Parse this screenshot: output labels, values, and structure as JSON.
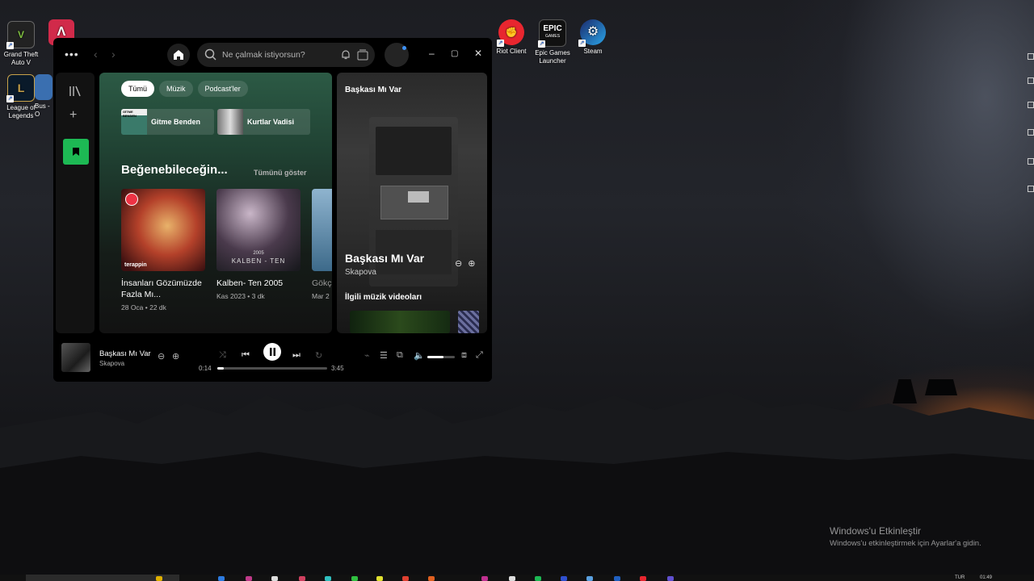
{
  "desktop": {
    "icons": [
      {
        "label": "Grand Theft Auto V",
        "icon": "gta-icon"
      },
      {
        "label": "League of Legends",
        "icon": "lol-icon"
      },
      {
        "label": "Bus - O",
        "icon": "app-icon"
      },
      {
        "label": "Riot Client",
        "icon": "riot-icon"
      },
      {
        "label": "Epic Games Launcher",
        "icon": "epic-icon"
      },
      {
        "label": "Steam",
        "icon": "steam-icon"
      }
    ],
    "epic_logo_text": "EPIC",
    "epic_logo_sub": "GAMES",
    "activation": {
      "title": "Windows'u Etkinleştir",
      "subtitle": "Windows'u etkinleştirmek için Ayarlar'a gidin."
    },
    "tray": {
      "lang": "TUR",
      "time": "01:49"
    }
  },
  "spotify": {
    "search": {
      "placeholder": "Ne çalmak istiyorsun?"
    },
    "chips": [
      "Tümü",
      "Müzik",
      "Podcast'ler"
    ],
    "active_chip": "Tümü",
    "quick": [
      {
        "title": "Gitme Benden",
        "thumb_text": "GİTME BENDEN"
      },
      {
        "title": "Kurtlar Vadisi"
      }
    ],
    "section": {
      "title": "Beğenebileceğin...",
      "more": "Tümünü göster"
    },
    "cards": [
      {
        "title": "İnsanları Gözümüzde Fazla Mı...",
        "sub": "28 Oca • 22 dk",
        "badge": "terappin"
      },
      {
        "title": "Kalben- Ten 2005",
        "sub": "Kas 2023 • 3 dk",
        "overlay_year": "2005",
        "overlay": "KALBEN - TEN"
      },
      {
        "title": "Gökçe Yıldız",
        "sub": "Mar 2"
      }
    ],
    "now_playing_panel": {
      "header": "Başkası Mı Var",
      "title": "Başkası Mı Var",
      "artist": "Skapova",
      "videos_header": "İlgili müzik videoları"
    },
    "player": {
      "title": "Başkası Mı Var",
      "artist": "Skapova",
      "elapsed": "0:14",
      "duration": "3:45",
      "progress": 0.062,
      "volume": 0.6
    }
  }
}
